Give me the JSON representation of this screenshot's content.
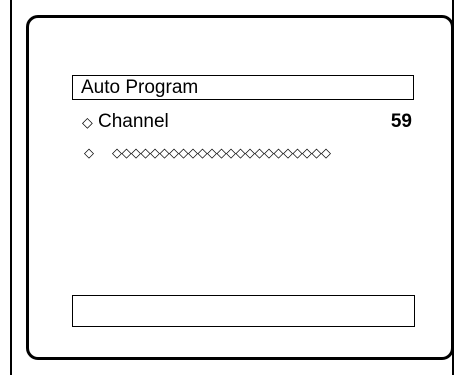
{
  "menu": {
    "title": "Auto Program"
  },
  "channel": {
    "bullet": "◇",
    "label": "Channel",
    "value": "59"
  },
  "progress": {
    "lead": "◇",
    "dots": "◇◇◇◇◇◇◇◇◇◇◇◇◇◇◇◇◇◇◇◇◇◇◇"
  },
  "status_bar": {
    "text": ""
  }
}
